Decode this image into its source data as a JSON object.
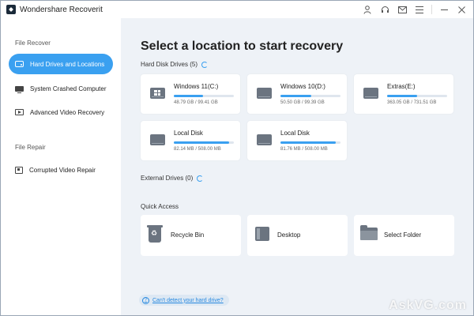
{
  "window": {
    "title": "Wondershare Recoverit"
  },
  "titlebar_icons": [
    "user-icon",
    "headset-icon",
    "mail-icon",
    "menu-icon",
    "minimize-icon",
    "close-icon"
  ],
  "sidebar": {
    "file_recover_label": "File Recover",
    "file_repair_label": "File Repair",
    "items": [
      {
        "label": "Hard Drives and Locations",
        "icon": "hard-drive-icon",
        "active": true
      },
      {
        "label": "System Crashed Computer",
        "icon": "monitor-icon",
        "active": false
      },
      {
        "label": "Advanced Video Recovery",
        "icon": "video-icon",
        "active": false
      },
      {
        "label": "Corrupted Video Repair",
        "icon": "video-repair-icon",
        "active": false
      }
    ]
  },
  "main": {
    "title": "Select a location to start recovery",
    "hard_disk_label": "Hard Disk Drives (5)",
    "external_label": "External Drives (0)",
    "quick_access_label": "Quick Access",
    "drives": [
      {
        "name": "Windows 11(C:)",
        "size": "48.79 GB / 99.41 GB",
        "used_fraction": 0.49,
        "windows": true
      },
      {
        "name": "Windows 10(D:)",
        "size": "50.50 GB / 99.39 GB",
        "used_fraction": 0.51,
        "windows": false
      },
      {
        "name": "Extras(E:)",
        "size": "363.05 GB / 731.51 GB",
        "used_fraction": 0.5,
        "windows": false
      },
      {
        "name": "Local Disk",
        "size": "82.14 MB / 508.00 MB",
        "used_fraction": 0.92,
        "windows": false
      },
      {
        "name": "Local Disk",
        "size": "81.76 MB / 508.00 MB",
        "used_fraction": 0.92,
        "windows": false
      }
    ],
    "quick_access": [
      {
        "label": "Recycle Bin",
        "icon": "recycle-bin-icon"
      },
      {
        "label": "Desktop",
        "icon": "desktop-icon"
      },
      {
        "label": "Select Folder",
        "icon": "folder-icon"
      }
    ],
    "help_link": "Can't detect your hard drive?"
  },
  "watermark": "AskVG.com",
  "colors": {
    "accent": "#3aa0f0",
    "main_bg": "#eef2f7",
    "sidebar_bg": "#ffffff"
  }
}
